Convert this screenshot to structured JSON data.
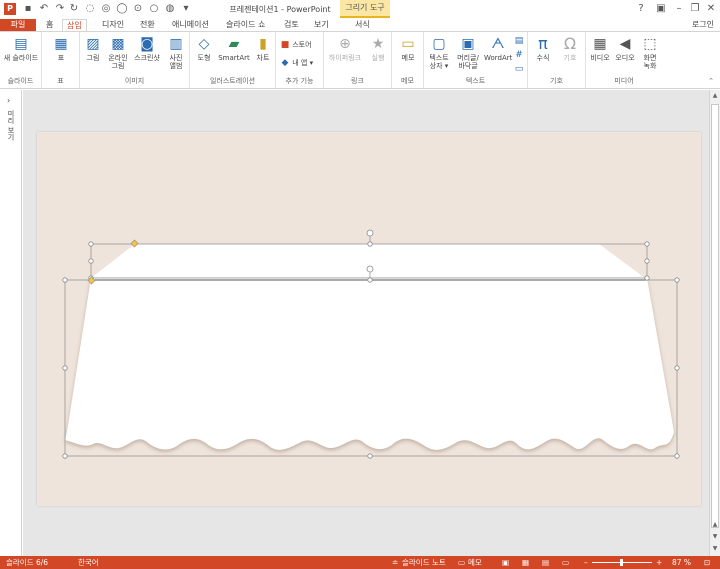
{
  "window": {
    "title": "프레젠테이션1 - PowerPoint",
    "context_tools": "그리기 도구",
    "help": "?",
    "minimize": "–",
    "restore": "❐",
    "close": "✕",
    "app_icon_letter": "P"
  },
  "qat": [
    "save-icon",
    "undo-icon",
    "redo-icon",
    "refresh-icon"
  ],
  "tabs": [
    {
      "id": "file",
      "label": "파일"
    },
    {
      "id": "home",
      "label": "홈"
    },
    {
      "id": "insert",
      "label": "삽입"
    },
    {
      "id": "design",
      "label": "디자인"
    },
    {
      "id": "transitions",
      "label": "전환"
    },
    {
      "id": "animations",
      "label": "애니메이션"
    },
    {
      "id": "slideshow",
      "label": "슬라이드 쇼"
    },
    {
      "id": "review",
      "label": "검토"
    },
    {
      "id": "view",
      "label": "보기"
    },
    {
      "id": "format",
      "label": "서식"
    }
  ],
  "login": "로그인",
  "ribbon": {
    "groups": {
      "slides": "슬라이드",
      "tables": "표",
      "images": "이미지",
      "illustrations": "일러스트레이션",
      "addins": "추가 기능",
      "links": "링크",
      "comments": "메모",
      "text": "텍스트",
      "symbols": "기호",
      "media": "미디어"
    },
    "buttons": {
      "new_slide": "새 슬라이드",
      "table": "표",
      "picture": "그림",
      "online_picture_1": "온라인",
      "online_picture_2": "그림",
      "screenshot": "스크린샷",
      "photo_album_1": "사진",
      "photo_album_2": "앨범",
      "shapes": "도형",
      "smartart": "SmartArt",
      "chart": "차트",
      "store": "스토어",
      "my_apps": "내 앱",
      "hyperlink": "하이퍼링크",
      "action": "실행",
      "comment": "메모",
      "textbox_1": "텍스트",
      "textbox_2": "상자",
      "header_footer_1": "머리글/",
      "header_footer_2": "바닥글",
      "wordart": "WordArt",
      "equation": "수식",
      "symbol": "기호",
      "video": "비디오",
      "audio": "오디오",
      "screen_recording_1": "화면",
      "screen_recording_2": "녹화"
    }
  },
  "left_pane": {
    "expand": "›",
    "label": "미리 보기"
  },
  "status": {
    "slide": "슬라이드 6/6",
    "language": "한국어",
    "notes": "슬라이드 노트",
    "comments": "메모",
    "zoom": "87 %"
  },
  "colors": {
    "accent": "#d24726",
    "slide_bg": "#efe4db",
    "tools_bg": "#fbe6a3"
  }
}
